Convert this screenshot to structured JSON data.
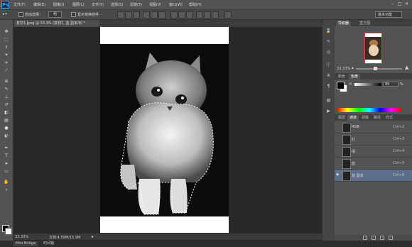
{
  "app": {
    "logo": "Ps"
  },
  "menu": [
    "文件(F)",
    "编辑(E)",
    "图像(I)",
    "图层(L)",
    "文字(Y)",
    "选择(S)",
    "滤镜(T)",
    "视图(V)",
    "窗口(W)",
    "帮助(H)"
  ],
  "window_controls": {
    "minimize": "–",
    "maximize": "□",
    "close": "✕"
  },
  "options": {
    "auto_select_label": "自动选择：",
    "auto_select_value": "组",
    "show_transform_label": "显示变换控件"
  },
  "workspace": "基本功能",
  "document": {
    "tab_title": "复材1.jpeg @ 33.3% (复材1, 蓝 副本/8) *",
    "zoom": "33.33%",
    "doc_size": "文档:4.59M/15.9M"
  },
  "bottom_tabs": [
    "Mini Bridge",
    "时间轴"
  ],
  "navigator": {
    "tabs": [
      "导航器",
      "直方图"
    ],
    "zoom": "33.33%"
  },
  "color_panel": {
    "tabs": [
      "颜色",
      "色板"
    ],
    "channel": "K",
    "value": "95",
    "unit": "%"
  },
  "channels_panel": {
    "tabs": [
      "图层",
      "通道",
      "调整",
      "路径",
      "样式"
    ],
    "rows": [
      {
        "name": "RGB",
        "shortcut": "Ctrl+2",
        "selected": false
      },
      {
        "name": "红",
        "shortcut": "Ctrl+3",
        "selected": false
      },
      {
        "name": "绿",
        "shortcut": "Ctrl+4",
        "selected": false
      },
      {
        "name": "蓝",
        "shortcut": "Ctrl+5",
        "selected": false
      },
      {
        "name": "蓝 副本",
        "shortcut": "Ctrl+6",
        "selected": true
      }
    ]
  },
  "tools": [
    "move-icon",
    "marquee-icon",
    "lasso-icon",
    "magic-wand-icon",
    "crop-icon",
    "eyedropper-icon",
    "healing-icon",
    "brush-icon",
    "stamp-icon",
    "history-brush-icon",
    "eraser-icon",
    "gradient-icon",
    "blur-icon",
    "dodge-icon",
    "pen-icon",
    "type-icon",
    "path-select-icon",
    "shape-icon",
    "hand-icon",
    "zoom-icon"
  ],
  "colors": {
    "accent_selected": "#5d6d8a",
    "nav_frame": "#e03a3a"
  }
}
